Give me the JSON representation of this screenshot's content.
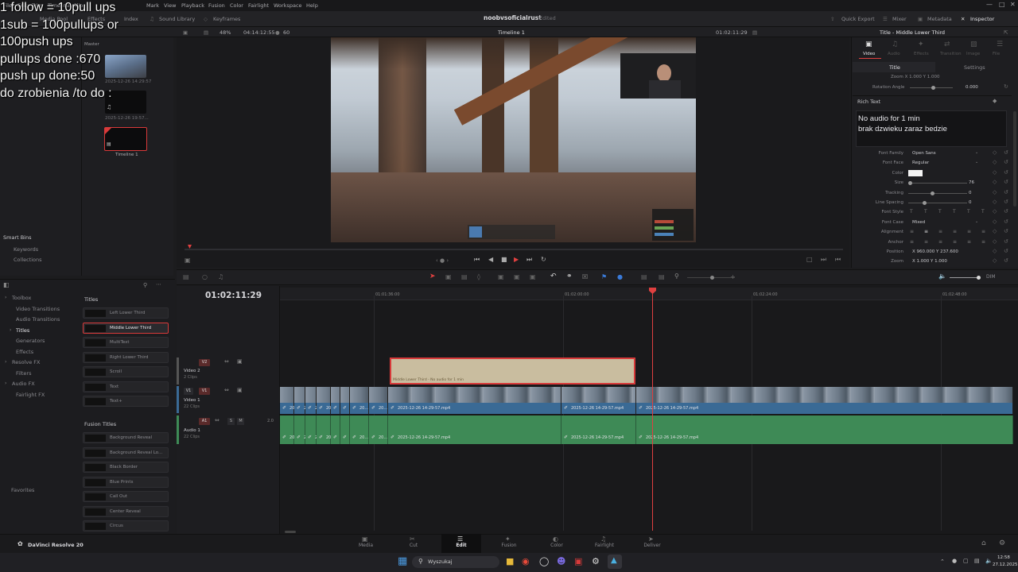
{
  "menu": [
    "File",
    "Edit",
    "Trim",
    "Timeline",
    "Clip",
    "Mark",
    "View",
    "Playback",
    "Fusion",
    "Color",
    "Fairlight",
    "Workspace",
    "Help"
  ],
  "top_tabs": {
    "media_pool": "Media Pool",
    "effects": "Effects",
    "index": "Index",
    "sound_library": "Sound Library",
    "keyframes": "Keyframes"
  },
  "project": {
    "name": "noobvsoficialrust",
    "status": "Edited"
  },
  "top_right": {
    "quick_export": "Quick Export",
    "mixer": "Mixer",
    "metadata": "Metadata",
    "inspector": "Inspector"
  },
  "viewer_bar": {
    "zoom": "48%",
    "timecode": "04:14:12:55",
    "fps": "60",
    "timeline_name": "Timeline 1",
    "current_tc": "01:02:11:29"
  },
  "inspector_title": "Title - Middle Lower Third",
  "inspector_tabs": [
    "Video",
    "Audio",
    "Effects",
    "Transition",
    "Image",
    "File"
  ],
  "inspector_subtabs": {
    "title": "Title",
    "settings": "Settings"
  },
  "overlay_lines": [
    "1 follow = 10pull ups",
    "1sub = 100pullups or",
    "100push ups",
    "pullups done :670",
    "push up done:50",
    "do zrobienia /to do :"
  ],
  "media_pool": {
    "master": "Master",
    "clips": [
      {
        "name": "2025-12-26 14:29:57"
      },
      {
        "name": "2025-12-26 19:57..."
      },
      {
        "name": "Timeline 1"
      }
    ]
  },
  "smart_bins": {
    "title": "Smart Bins",
    "items": [
      "Keywords",
      "Collections"
    ]
  },
  "toolbox_tree": [
    {
      "label": "Toolbox",
      "indent": 0
    },
    {
      "label": "Video Transitions",
      "indent": 1
    },
    {
      "label": "Audio Transitions",
      "indent": 1
    },
    {
      "label": "Titles",
      "indent": 1,
      "active": true
    },
    {
      "label": "Generators",
      "indent": 1
    },
    {
      "label": "Effects",
      "indent": 1
    },
    {
      "label": "Resolve FX",
      "indent": 0
    },
    {
      "label": "Filters",
      "indent": 1
    },
    {
      "label": "Audio FX",
      "indent": 0
    },
    {
      "label": "Fairlight FX",
      "indent": 1
    }
  ],
  "favorites": "Favorites",
  "titles_section": "Titles",
  "titles": [
    "Left Lower Third",
    "Middle Lower Third",
    "MultiText",
    "Right Lower Third",
    "Scroll",
    "Text",
    "Text+"
  ],
  "fusion_titles_section": "Fusion Titles",
  "fusion_titles": [
    "Background Reveal",
    "Background Reveal Lo...",
    "Black Border",
    "Blue Prints",
    "Call Out",
    "Center Reveal",
    "Circus"
  ],
  "rich_text": {
    "label": "Rich Text",
    "lines": [
      "No audio for 1 min",
      "brak dzwieku zaraz bedzie"
    ]
  },
  "inspector_props": [
    {
      "key": "Font Family",
      "value": "Open Sans"
    },
    {
      "key": "Font Face",
      "value": "Regular"
    },
    {
      "key": "Color",
      "value": ""
    },
    {
      "key": "Size",
      "value": "76"
    },
    {
      "key": "Tracking",
      "value": "0"
    },
    {
      "key": "Line Spacing",
      "value": "0"
    },
    {
      "key": "Font Style",
      "value": ""
    },
    {
      "key": "Font Case",
      "value": "Mixed"
    },
    {
      "key": "Alignment",
      "value": ""
    },
    {
      "key": "Anchor",
      "value": ""
    },
    {
      "key": "Position",
      "value": "X 960.000   Y 237.600"
    },
    {
      "key": "Zoom",
      "value": "X 1.000   Y 1.000"
    }
  ],
  "top_props": {
    "zoom_row": "Zoom  X 1.000  Y 1.000",
    "rotation": "Rotation Angle",
    "rotation_val": "0.000"
  },
  "timeline": {
    "timecode": "01:02:11:29",
    "ruler": [
      "01:01:36:00",
      "01:02:00:00",
      "01:02:24:00",
      "01:02:48:00"
    ],
    "tracks": [
      {
        "id": "V2",
        "name": "Video 2",
        "count": "2 Clips"
      },
      {
        "id": "V1",
        "name": "Video 1",
        "count": "22 Clips"
      },
      {
        "id": "A1",
        "name": "Audio 1",
        "count": "22 Clips",
        "level": "2.0"
      }
    ],
    "title_clip": "Middle Lower Third - No audio for 1 min",
    "clip_name": "2025-12-26 14-29-57.mp4",
    "short_clip": "20..."
  },
  "dim": "DIM",
  "pages": [
    "Media",
    "Cut",
    "Edit",
    "Fusion",
    "Color",
    "Fairlight",
    "Deliver"
  ],
  "app_name": "DaVinci Resolve 20",
  "taskbar": {
    "search": "Wyszukaj",
    "time": "12:58",
    "date": "27.12.2025"
  }
}
